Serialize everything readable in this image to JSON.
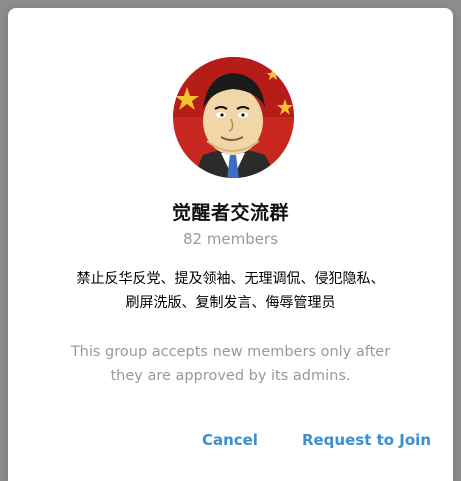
{
  "group": {
    "name": "觉醒者交流群",
    "members": "82 members",
    "description_line1": "禁止反华反党、提及领袖、无理调侃、侵犯隐私、",
    "description_line2": "刷屏洗版、复制发言、侮辱管理员"
  },
  "approval": {
    "line1": "This group accepts new members only after",
    "line2": "they are approved by its admins."
  },
  "buttons": {
    "cancel": "Cancel",
    "request": "Request to Join"
  },
  "colors": {
    "accent": "#3a8fd0",
    "flag_red": "#c8271f",
    "flag_yellow": "#f2c230"
  }
}
